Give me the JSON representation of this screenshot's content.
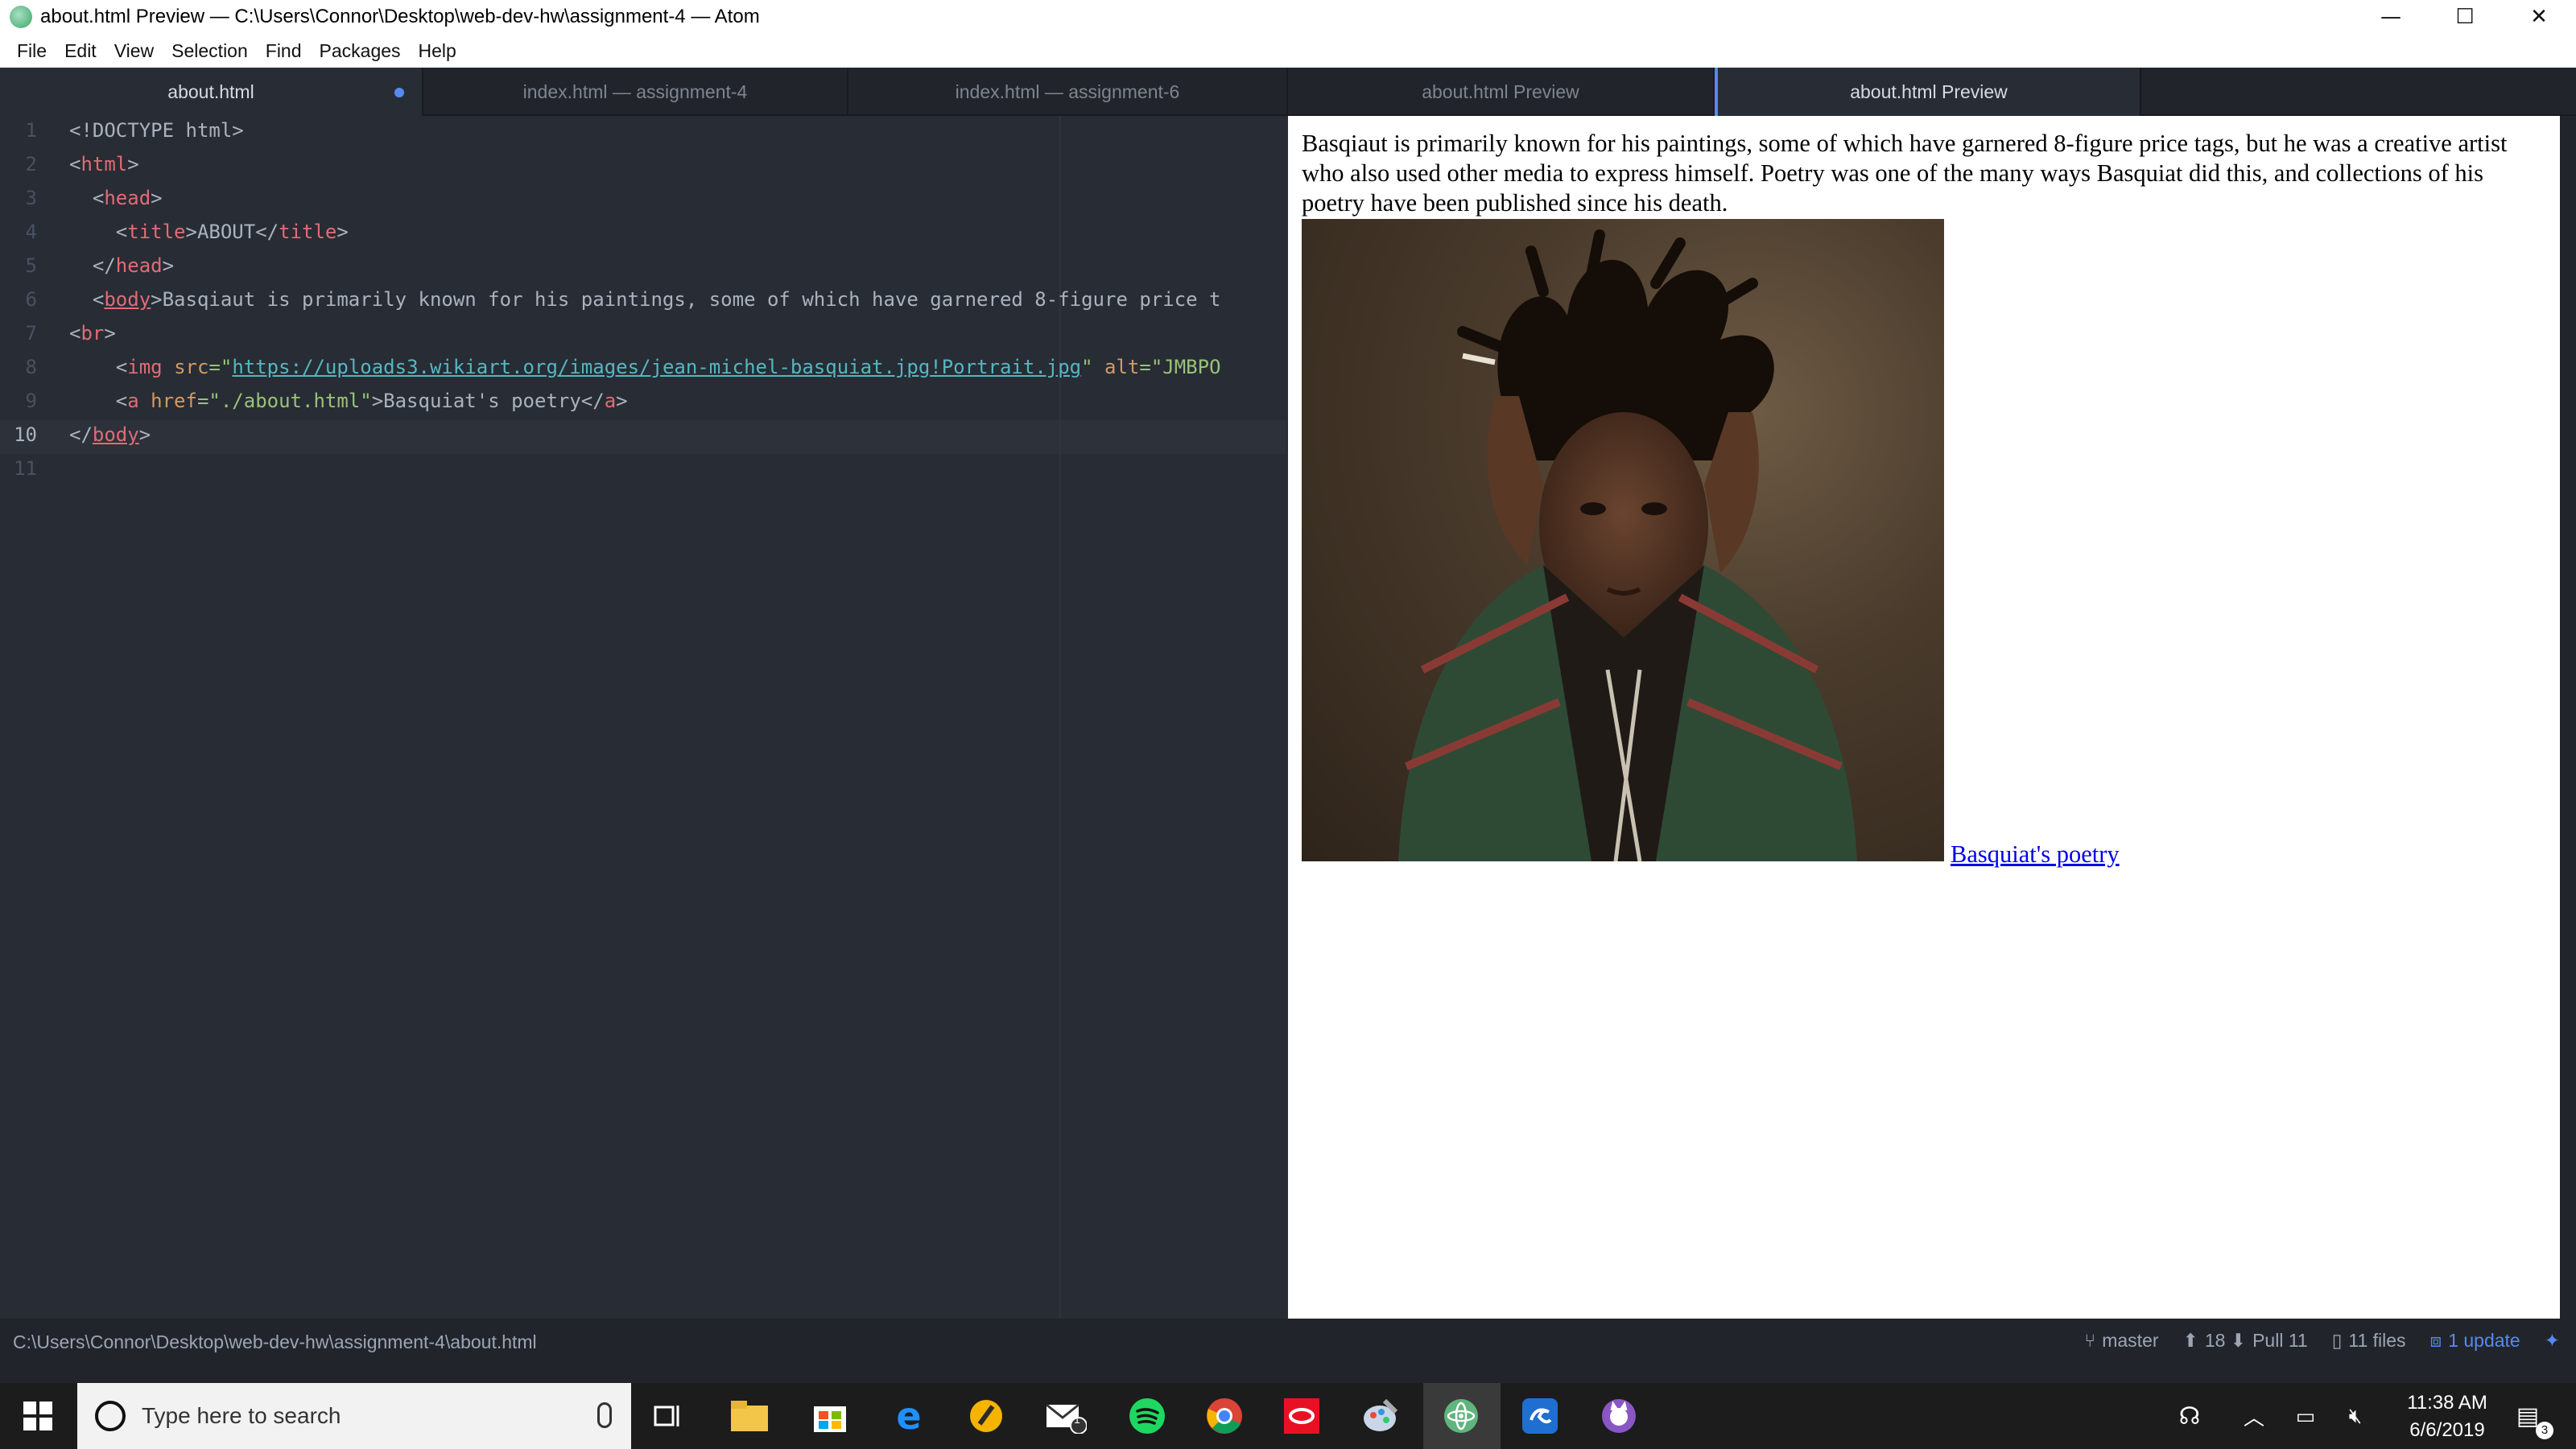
{
  "window": {
    "title": "about.html Preview — C:\\Users\\Connor\\Desktop\\web-dev-hw\\assignment-4 — Atom",
    "minimize": "—",
    "maximize": "☐",
    "close": "✕"
  },
  "menu": [
    "File",
    "Edit",
    "View",
    "Selection",
    "Find",
    "Packages",
    "Help"
  ],
  "tabs": {
    "left": [
      {
        "label": "about.html",
        "active": true,
        "modified": true
      },
      {
        "label": "index.html — assignment-4",
        "active": false
      },
      {
        "label": "index.html — assignment-6",
        "active": false
      }
    ],
    "right": [
      {
        "label": "about.html Preview",
        "active": false
      },
      {
        "label": "about.html Preview",
        "active": true
      }
    ]
  },
  "editor": {
    "line_numbers": [
      "1",
      "2",
      "3",
      "4",
      "5",
      "6",
      "7",
      "8",
      "9",
      "10",
      "11"
    ],
    "current_line": "10",
    "lines": {
      "l1": {
        "a": "<!DOCTYPE html>"
      },
      "l2": {
        "a": "<",
        "b": "html",
        "c": ">"
      },
      "l3": {
        "a": "  <",
        "b": "head",
        "c": ">"
      },
      "l4": {
        "a": "    <",
        "b": "title",
        "c": ">ABOUT</",
        "d": "title",
        "e": ">"
      },
      "l5": {
        "a": "  </",
        "b": "head",
        "c": ">"
      },
      "l6": {
        "a": "  <",
        "b": "body",
        "c": ">Basqiaut is primarily known for his paintings, some of which have garnered 8-figure price t"
      },
      "l7": {
        "a": "<",
        "b": "br",
        "c": ">"
      },
      "l8": {
        "a": "    <",
        "b": "img",
        "c": " ",
        "d": "src",
        "e": "=\"",
        "f": "https://uploads3.wikiart.org/images/jean-michel-basquiat.jpg!Portrait.jpg",
        "g": "\"",
        "h": " alt",
        "i": "=\"JMBPO"
      },
      "l9": {
        "a": "    <",
        "b": "a",
        "c": " ",
        "d": "href",
        "e": "=\"./about.html\"",
        "f": ">Basquiat's poetry</",
        "g": "a",
        "h": ">"
      },
      "l10": {
        "a": "</",
        "b": "body",
        "c": ">"
      }
    }
  },
  "preview": {
    "paragraph": "Basqiaut is primarily known for his paintings, some of which have garnered 8-figure price tags, but he was a creative artist who also used other media to express himself. Poetry was one of the many ways Basquiat did this, and collections of his poetry have been published since his death.",
    "link_text": "Basquiat's poetry"
  },
  "status": {
    "path": "C:\\Users\\Connor\\Desktop\\web-dev-hw\\assignment-4\\about.html",
    "branch": "master",
    "push_count": "18",
    "pull_label": "Pull 11",
    "files": "11 files",
    "update": "1 update"
  },
  "taskbar": {
    "search_placeholder": "Type here to search",
    "time": "11:38 AM",
    "date": "6/6/2019",
    "mail_badge": "1",
    "notif_badge": "3"
  },
  "colors": {
    "accent": "#568af2",
    "editor_bg": "#282c34",
    "tag": "#e06c75",
    "attr": "#d19a66",
    "string": "#98c379",
    "link": "#56b6c2"
  }
}
